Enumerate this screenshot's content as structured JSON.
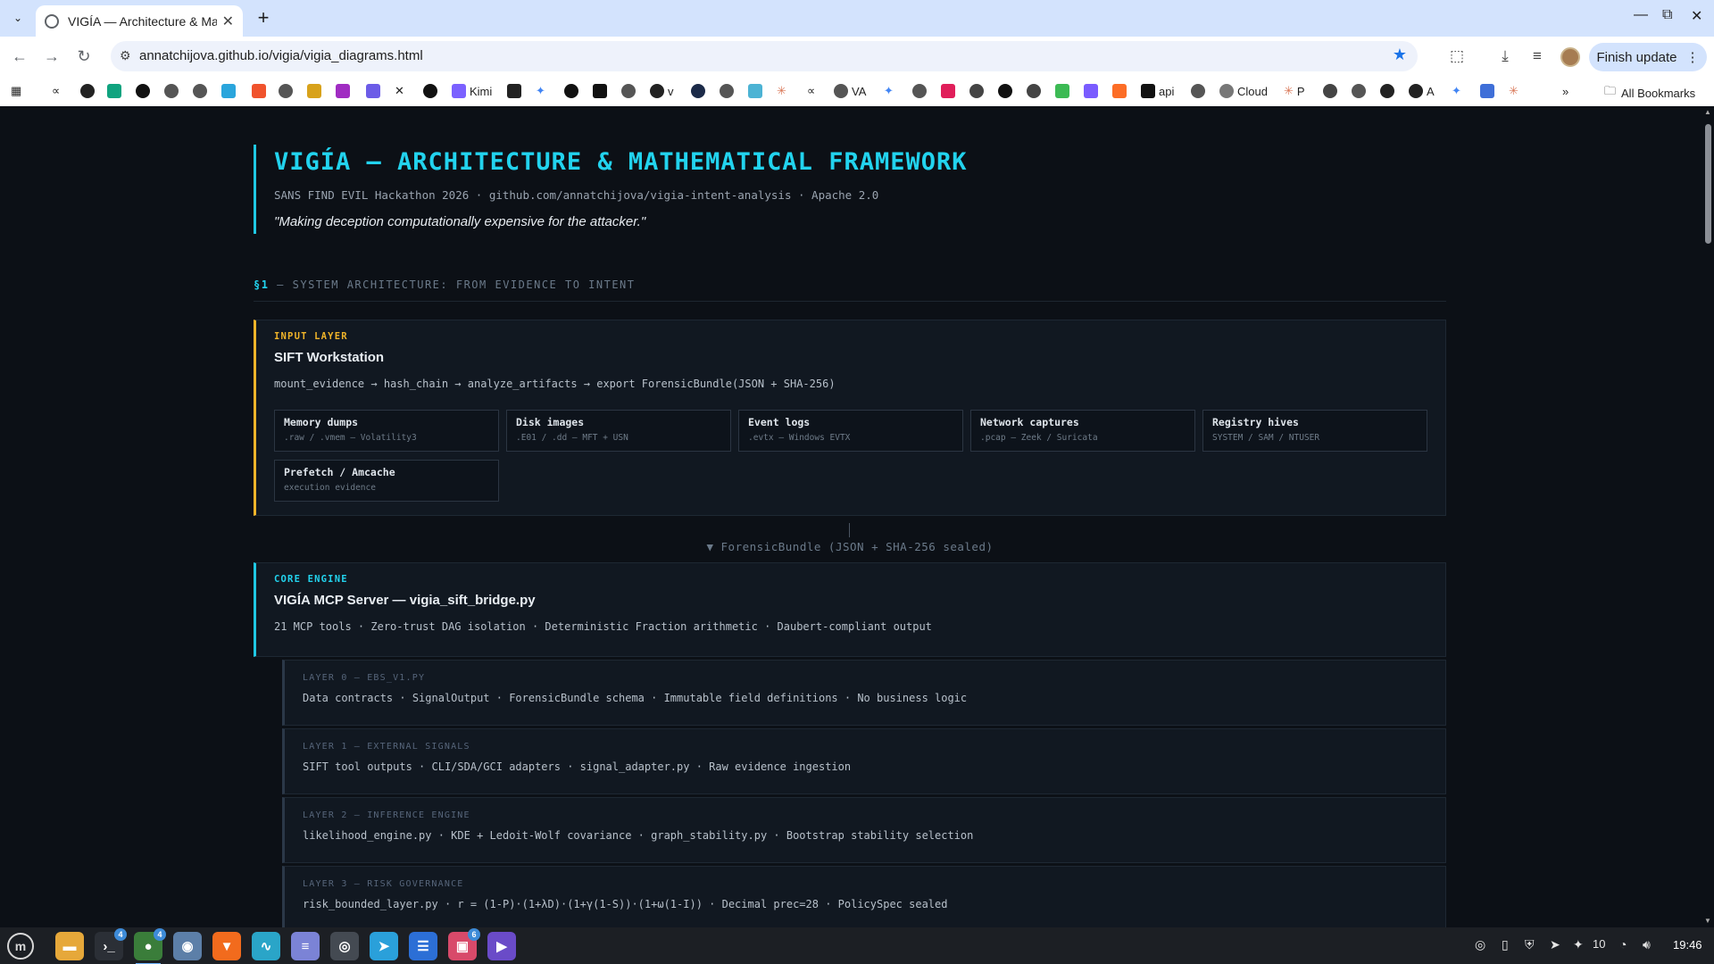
{
  "browser": {
    "tab_title": "VIGÍA — Architecture & Math",
    "url": "annatchijova.github.io/vigia/vigia_diagrams.html",
    "finish_update": "Finish update",
    "bookmarks": {
      "kimi": "Kimi",
      "v": "v",
      "va": "VA",
      "api": "api",
      "cloud": "Cloud",
      "p": "P",
      "a": "A",
      "all": "All Bookmarks"
    }
  },
  "page": {
    "title": "VIGÍA — ARCHITECTURE & MATHEMATICAL FRAMEWORK",
    "subtitle": "SANS FIND EVIL Hackathon 2026 · github.com/annatchijova/vigia-intent-analysis · Apache 2.0",
    "quote": "\"Making deception computationally expensive for the attacker.\"",
    "section": {
      "number": "§1",
      "title": " — SYSTEM ARCHITECTURE: FROM EVIDENCE TO INTENT"
    },
    "input_layer": {
      "kicker": "INPUT LAYER",
      "title": "SIFT Workstation",
      "pipeline": "mount_evidence → hash_chain → analyze_artifacts → export ForensicBundle(JSON + SHA-256)",
      "sources": [
        {
          "name": "Memory dumps",
          "detail": ".raw / .vmem — Volatility3"
        },
        {
          "name": "Disk images",
          "detail": ".E01 / .dd — MFT + USN"
        },
        {
          "name": "Event logs",
          "detail": ".evtx — Windows EVTX"
        },
        {
          "name": "Network captures",
          "detail": ".pcap — Zeek / Suricata"
        },
        {
          "name": "Registry hives",
          "detail": "SYSTEM / SAM / NTUSER"
        },
        {
          "name": "Prefetch / Amcache",
          "detail": "execution evidence"
        }
      ]
    },
    "bundle_label": "▼ ForensicBundle (JSON + SHA-256 sealed)",
    "core_engine": {
      "kicker": "CORE ENGINE",
      "title": "VIGÍA MCP Server — vigia_sift_bridge.py",
      "features": "21 MCP tools · Zero-trust DAG isolation · Deterministic Fraction arithmetic · Daubert-compliant output"
    },
    "layers": [
      {
        "head": "LAYER 0 — EBS_V1.PY",
        "body": "Data contracts · SignalOutput · ForensicBundle schema · Immutable field definitions · No business logic"
      },
      {
        "head": "LAYER 1 — EXTERNAL SIGNALS",
        "body": "SIFT tool outputs · CLI/SDA/GCI adapters · signal_adapter.py · Raw evidence ingestion"
      },
      {
        "head": "LAYER 2 — INFERENCE ENGINE",
        "body": "likelihood_engine.py · KDE + Ledoit-Wolf covariance · graph_stability.py · Bootstrap stability selection"
      },
      {
        "head": "LAYER 3 — RISK GOVERNANCE",
        "body": "risk_bounded_layer.py · r = (1-P)·(1+λD)·(1+γ(1-S))·(1+ω(1-I)) · Decimal prec=28 · PolicySpec sealed"
      }
    ]
  },
  "taskbar": {
    "badges": {
      "terminal": "4",
      "chrome": "4",
      "photos": "6"
    },
    "tray_count": "10",
    "clock": "19:46"
  },
  "colors": {
    "accent_cyan": "#22d3ee",
    "accent_amber": "#f0b429",
    "page_bg": "#0c1016",
    "card_bg": "#111821"
  }
}
